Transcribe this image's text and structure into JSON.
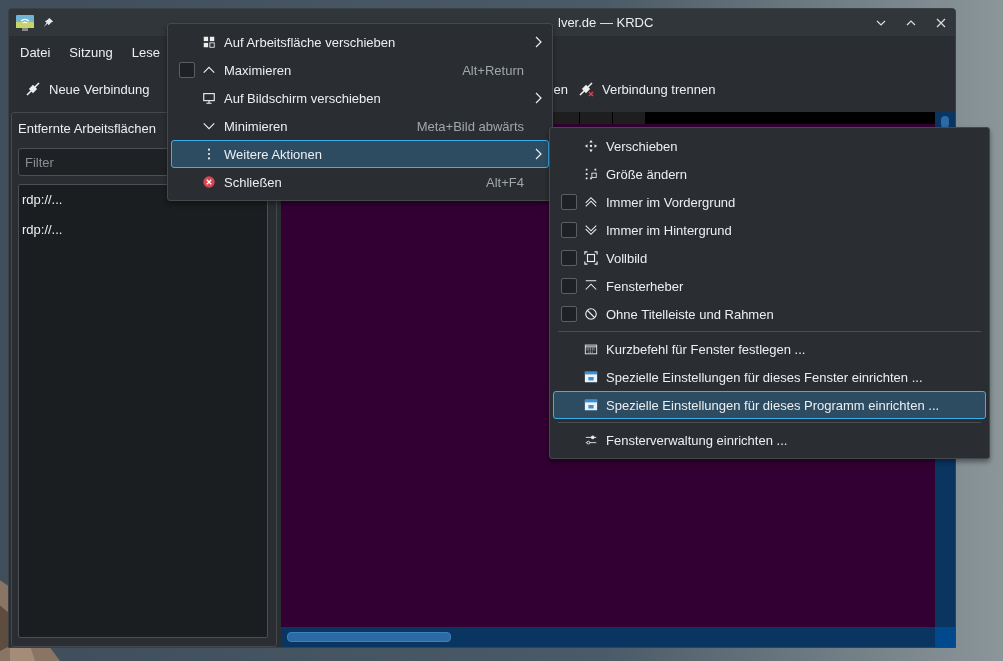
{
  "window": {
    "title": "lver.de — KRDC"
  },
  "menubar": [
    "Datei",
    "Sitzung",
    "Lese"
  ],
  "toolbar": [
    {
      "label": "Neue Verbindung"
    },
    {
      "label": "en"
    },
    {
      "label": "Verbindung trennen"
    }
  ],
  "sidebar": {
    "title": "Entfernte Arbeitsflächen",
    "filter": {
      "placeholder": "Filter"
    },
    "items": [
      "rdp://...",
      "rdp://..."
    ]
  },
  "window_menu": {
    "items": [
      {
        "kind": "action",
        "label": "Auf Arbeitsfläche verschieben",
        "submenu": true,
        "selected": false
      },
      {
        "kind": "checkbox",
        "label": "Maximieren",
        "shortcut": "Alt+Return",
        "checked": false,
        "selected": false
      },
      {
        "kind": "action",
        "label": "Auf Bildschirm verschieben",
        "submenu": true,
        "selected": false
      },
      {
        "kind": "action",
        "label": "Minimieren",
        "shortcut": "Meta+Bild abwärts",
        "selected": false
      },
      {
        "kind": "action",
        "label": "Weitere Aktionen",
        "submenu": true,
        "selected": true
      },
      {
        "kind": "action",
        "label": "Schließen",
        "shortcut": "Alt+F4",
        "selected": false
      }
    ]
  },
  "submenu": {
    "items": [
      {
        "kind": "action",
        "label": "Verschieben",
        "selected": false
      },
      {
        "kind": "action",
        "label": "Größe ändern",
        "selected": false
      },
      {
        "kind": "checkbox",
        "label": "Immer im Vordergrund",
        "checked": false,
        "selected": false
      },
      {
        "kind": "checkbox",
        "label": "Immer im Hintergrund",
        "checked": false,
        "selected": false
      },
      {
        "kind": "checkbox",
        "label": "Vollbild",
        "checked": false,
        "selected": false
      },
      {
        "kind": "checkbox",
        "label": "Fensterheber",
        "checked": false,
        "selected": false
      },
      {
        "kind": "checkbox",
        "label": "Ohne Titelleiste und Rahmen",
        "checked": false,
        "selected": false
      },
      {
        "kind": "separator"
      },
      {
        "kind": "action",
        "label": "Kurzbefehl für Fenster festlegen ...",
        "selected": false
      },
      {
        "kind": "action",
        "label": "Spezielle Einstellungen für dieses Fenster einrichten ...",
        "selected": false
      },
      {
        "kind": "action",
        "label": "Spezielle Einstellungen für dieses Programm einrichten ...",
        "selected": true
      },
      {
        "kind": "separator"
      },
      {
        "kind": "action",
        "label": "Fensterverwaltung einrichten ...",
        "selected": false
      }
    ]
  }
}
